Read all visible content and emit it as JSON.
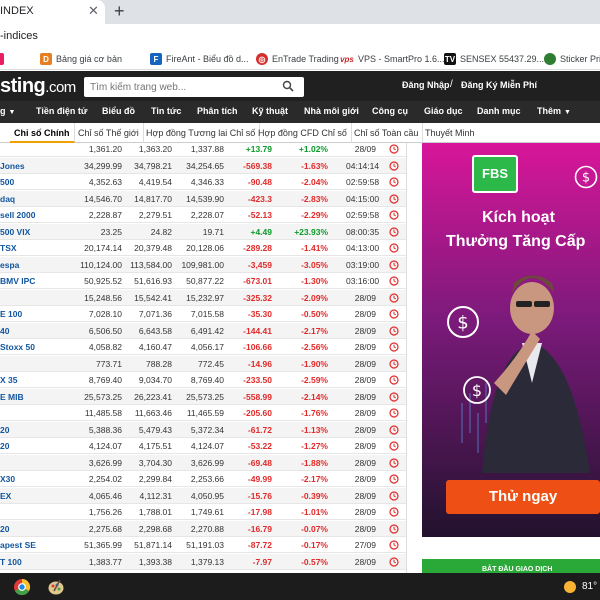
{
  "browser": {
    "tab_title": "INDEX",
    "url_fragment": "-indices"
  },
  "bookmarks": [
    {
      "label": "Bảng giá cơ bản",
      "color": "#e67e22",
      "glyph": "D"
    },
    {
      "label": "FireAnt - Biểu đồ d...",
      "color": "#1565c0",
      "glyph": "F"
    },
    {
      "label": "EnTrade Trading",
      "color": "#d32f2f",
      "glyph": "◎"
    },
    {
      "label": "VPS - SmartPro 1.6....",
      "color": "#c62828",
      "glyph": "v"
    },
    {
      "label": "SENSEX 55437.29....",
      "color": "#111111",
      "glyph": "TV"
    },
    {
      "label": "Sticker Pric",
      "color": "#2e7d32",
      "glyph": "●"
    }
  ],
  "site": {
    "logo_main": "sting",
    "logo_suffix": ".com",
    "search_placeholder": "Tìm kiếm trang web...",
    "login": "Đăng Nhập",
    "slash": "/",
    "register": "Đăng Ký Miễn Phí"
  },
  "nav": [
    {
      "label": "g",
      "caret": true
    },
    {
      "label": "Tiền điện tử",
      "caret": false
    },
    {
      "label": "Biểu đồ",
      "caret": false
    },
    {
      "label": "Tin tức",
      "caret": false
    },
    {
      "label": "Phân tích",
      "caret": false
    },
    {
      "label": "Kỹ thuật",
      "caret": false
    },
    {
      "label": "Nhà môi giới",
      "caret": false
    },
    {
      "label": "Công cụ",
      "caret": false
    },
    {
      "label": "Giáo dục",
      "caret": false
    },
    {
      "label": "Danh mục",
      "caret": false
    },
    {
      "label": "Thêm",
      "caret": true
    }
  ],
  "subnav": [
    {
      "label": "Chỉ số Chính",
      "active": true
    },
    {
      "label": "Chỉ số Thế giới",
      "active": false
    },
    {
      "label": "Hợp đồng Tương lai Chỉ số",
      "active": false
    },
    {
      "label": "Hợp đồng CFD Chỉ số",
      "active": false
    },
    {
      "label": "Chỉ số Toàn cầu",
      "active": false
    },
    {
      "label": "Thuyết Minh",
      "active": false
    }
  ],
  "indices": [
    {
      "name": "",
      "last": "1,361.20",
      "high": "1,363.20",
      "low": "1,337.88",
      "chg": "+13.79",
      "pct": "+1.02%",
      "time": "28/09",
      "dir": "up"
    },
    {
      "name": "Jones",
      "last": "34,299.99",
      "high": "34,798.21",
      "low": "34,254.65",
      "chg": "-569.38",
      "pct": "-1.63%",
      "time": "04:14:14",
      "dir": "down"
    },
    {
      "name": "500",
      "last": "4,352.63",
      "high": "4,419.54",
      "low": "4,346.33",
      "chg": "-90.48",
      "pct": "-2.04%",
      "time": "02:59:58",
      "dir": "down"
    },
    {
      "name": "daq",
      "last": "14,546.70",
      "high": "14,817.70",
      "low": "14,539.90",
      "chg": "-423.3",
      "pct": "-2.83%",
      "time": "04:15:00",
      "dir": "down"
    },
    {
      "name": "sell 2000",
      "last": "2,228.87",
      "high": "2,279.51",
      "low": "2,228.07",
      "chg": "-52.13",
      "pct": "-2.29%",
      "time": "02:59:58",
      "dir": "down"
    },
    {
      "name": "500 VIX",
      "last": "23.25",
      "high": "24.82",
      "low": "19.71",
      "chg": "+4.49",
      "pct": "+23.93%",
      "time": "08:00:35",
      "dir": "up"
    },
    {
      "name": "TSX",
      "last": "20,174.14",
      "high": "20,379.48",
      "low": "20,128.06",
      "chg": "-289.28",
      "pct": "-1.41%",
      "time": "04:13:00",
      "dir": "down"
    },
    {
      "name": "espa",
      "last": "110,124.00",
      "high": "113,584.00",
      "low": "109,981.00",
      "chg": "-3,459",
      "pct": "-3.05%",
      "time": "03:19:00",
      "dir": "down"
    },
    {
      "name": "BMV IPC",
      "last": "50,925.52",
      "high": "51,616.93",
      "low": "50,877.22",
      "chg": "-673.01",
      "pct": "-1.30%",
      "time": "03:16:00",
      "dir": "down"
    },
    {
      "name": "",
      "last": "15,248.56",
      "high": "15,542.41",
      "low": "15,232.97",
      "chg": "-325.32",
      "pct": "-2.09%",
      "time": "28/09",
      "dir": "down"
    },
    {
      "name": "E 100",
      "last": "7,028.10",
      "high": "7,071.36",
      "low": "7,015.58",
      "chg": "-35.30",
      "pct": "-0.50%",
      "time": "28/09",
      "dir": "down"
    },
    {
      "name": "40",
      "last": "6,506.50",
      "high": "6,643.58",
      "low": "6,491.42",
      "chg": "-144.41",
      "pct": "-2.17%",
      "time": "28/09",
      "dir": "down"
    },
    {
      "name": "Stoxx 50",
      "last": "4,058.82",
      "high": "4,160.47",
      "low": "4,056.17",
      "chg": "-106.66",
      "pct": "-2.56%",
      "time": "28/09",
      "dir": "down"
    },
    {
      "name": "",
      "last": "773.71",
      "high": "788.28",
      "low": "772.45",
      "chg": "-14.96",
      "pct": "-1.90%",
      "time": "28/09",
      "dir": "down"
    },
    {
      "name": "X 35",
      "last": "8,769.40",
      "high": "9,034.70",
      "low": "8,769.40",
      "chg": "-233.50",
      "pct": "-2.59%",
      "time": "28/09",
      "dir": "down"
    },
    {
      "name": "E MIB",
      "last": "25,573.25",
      "high": "26,223.41",
      "low": "25,573.25",
      "chg": "-558.99",
      "pct": "-2.14%",
      "time": "28/09",
      "dir": "down"
    },
    {
      "name": "",
      "last": "11,485.58",
      "high": "11,663.46",
      "low": "11,465.59",
      "chg": "-205.60",
      "pct": "-1.76%",
      "time": "28/09",
      "dir": "down"
    },
    {
      "name": "20",
      "last": "5,388.36",
      "high": "5,479.43",
      "low": "5,372.34",
      "chg": "-61.72",
      "pct": "-1.13%",
      "time": "28/09",
      "dir": "down"
    },
    {
      "name": "20",
      "last": "4,124.07",
      "high": "4,175.51",
      "low": "4,124.07",
      "chg": "-53.22",
      "pct": "-1.27%",
      "time": "28/09",
      "dir": "down"
    },
    {
      "name": "",
      "last": "3,626.99",
      "high": "3,704.30",
      "low": "3,626.99",
      "chg": "-69.48",
      "pct": "-1.88%",
      "time": "28/09",
      "dir": "down"
    },
    {
      "name": "X30",
      "last": "2,254.02",
      "high": "2,299.84",
      "low": "2,253.66",
      "chg": "-49.99",
      "pct": "-2.17%",
      "time": "28/09",
      "dir": "down"
    },
    {
      "name": "EX",
      "last": "4,065.46",
      "high": "4,112.31",
      "low": "4,050.95",
      "chg": "-15.76",
      "pct": "-0.39%",
      "time": "28/09",
      "dir": "down"
    },
    {
      "name": "",
      "last": "1,756.26",
      "high": "1,788.01",
      "low": "1,749.61",
      "chg": "-17.98",
      "pct": "-1.01%",
      "time": "28/09",
      "dir": "down"
    },
    {
      "name": "20",
      "last": "2,275.68",
      "high": "2,298.68",
      "low": "2,270.88",
      "chg": "-16.79",
      "pct": "-0.07%",
      "time": "28/09",
      "dir": "down"
    },
    {
      "name": "apest SE",
      "last": "51,365.99",
      "high": "51,871.14",
      "low": "51,191.03",
      "chg": "-87.72",
      "pct": "-0.17%",
      "time": "27/09",
      "dir": "down"
    },
    {
      "name": "T 100",
      "last": "1,383.77",
      "high": "1,393.38",
      "low": "1,379.13",
      "chg": "-7.97",
      "pct": "-0.57%",
      "time": "28/09",
      "dir": "down"
    }
  ],
  "ad": {
    "brand": "FBS",
    "headline1": "Kích hoạt",
    "headline2": "Thưởng Tăng Cấp",
    "cta": "Thử ngay",
    "accent_green": "#2db84a",
    "accent_orange": "#ee4f14"
  },
  "bottom_banner": "BẮT ĐẦU GIAO DỊCH",
  "taskbar": {
    "temperature": "81°"
  },
  "colors": {
    "up": "#0a9a2a",
    "down": "#e12a2a",
    "header_bg": "#202020"
  }
}
